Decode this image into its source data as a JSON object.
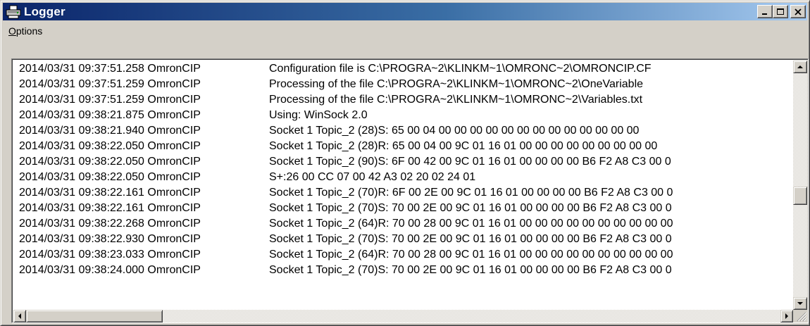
{
  "window": {
    "title": "Logger",
    "icon": "printer-icon",
    "buttons": [
      "minimize-icon",
      "maximize-icon",
      "close-icon"
    ]
  },
  "menu": {
    "items": [
      {
        "mnemonic": "O",
        "rest": "ptions"
      }
    ]
  },
  "log": {
    "lines": [
      {
        "timestamp": "2014/03/31 09:37:51.258 OmronCIP",
        "message": "Configuration file is C:\\PROGRA~2\\KLINKM~1\\OMRONC~2\\OMRONCIP.CF"
      },
      {
        "timestamp": "2014/03/31 09:37:51.259 OmronCIP",
        "message": "Processing of the file C:\\PROGRA~2\\KLINKM~1\\OMRONC~2\\OneVariable"
      },
      {
        "timestamp": "2014/03/31 09:37:51.259 OmronCIP",
        "message": "Processing of the file C:\\PROGRA~2\\KLINKM~1\\OMRONC~2\\Variables.txt"
      },
      {
        "timestamp": "2014/03/31 09:38:21.875 OmronCIP",
        "message": "Using: WinSock 2.0"
      },
      {
        "timestamp": "2014/03/31 09:38:21.940 OmronCIP",
        "message": "Socket 1 Topic_2 (28)S: 65 00 04 00 00 00 00 00 00 00 00 00 00 00 00 00"
      },
      {
        "timestamp": "2014/03/31 09:38:22.050 OmronCIP",
        "message": "Socket 1 Topic_2 (28)R: 65 00 04 00 9C 01 16 01 00 00 00 00 00 00 00 00 00"
      },
      {
        "timestamp": "2014/03/31 09:38:22.050 OmronCIP",
        "message": "Socket 1 Topic_2 (90)S: 6F 00 42 00 9C 01 16 01 00 00 00 00 B6 F2 A8 C3 00 0"
      },
      {
        "timestamp": "2014/03/31 09:38:22.050 OmronCIP",
        "message": "S+:26 00 CC 07 00 42 A3 02 20 02 24 01"
      },
      {
        "timestamp": "2014/03/31 09:38:22.161 OmronCIP",
        "message": "Socket 1 Topic_2 (70)R: 6F 00 2E 00 9C 01 16 01 00 00 00 00 B6 F2 A8 C3 00 0"
      },
      {
        "timestamp": "2014/03/31 09:38:22.161 OmronCIP",
        "message": "Socket 1 Topic_2 (70)S: 70 00 2E 00 9C 01 16 01 00 00 00 00 B6 F2 A8 C3 00 0"
      },
      {
        "timestamp": "2014/03/31 09:38:22.268 OmronCIP",
        "message": "Socket 1 Topic_2 (64)R: 70 00 28 00 9C 01 16 01 00 00 00 00 00 00 00 00 00 00"
      },
      {
        "timestamp": "2014/03/31 09:38:22.930 OmronCIP",
        "message": "Socket 1 Topic_2 (70)S: 70 00 2E 00 9C 01 16 01 00 00 00 00 B6 F2 A8 C3 00 0"
      },
      {
        "timestamp": "2014/03/31 09:38:23.033 OmronCIP",
        "message": "Socket 1 Topic_2 (64)R: 70 00 28 00 9C 01 16 01 00 00 00 00 00 00 00 00 00 00"
      },
      {
        "timestamp": "2014/03/31 09:38:24.000 OmronCIP",
        "message": "Socket 1 Topic_2 (70)S: 70 00 2E 00 9C 01 16 01 00 00 00 00 B6 F2 A8 C3 00 0"
      }
    ]
  },
  "scrollbars": {
    "vertical": {
      "position": 0.55
    },
    "horizontal": {
      "position": 0.0
    }
  }
}
